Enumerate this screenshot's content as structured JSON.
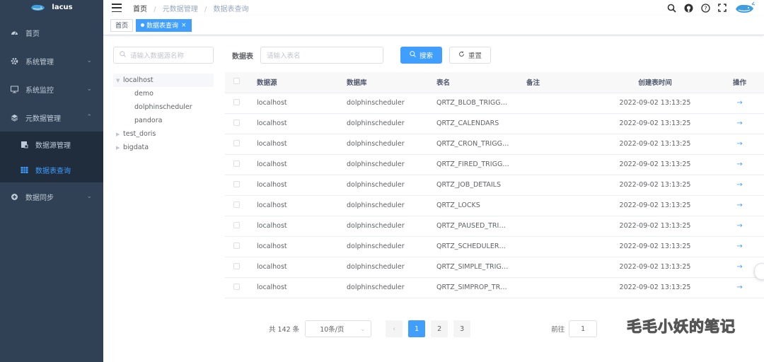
{
  "app": {
    "name": "lacus"
  },
  "sidebar": {
    "items": [
      {
        "label": "首页",
        "icon": "dashboard-icon"
      },
      {
        "label": "系统管理",
        "icon": "gear-icon",
        "expandable": true
      },
      {
        "label": "系统监控",
        "icon": "monitor-icon",
        "expandable": true
      },
      {
        "label": "元数据管理",
        "icon": "layers-icon",
        "expanded": true,
        "children": [
          {
            "label": "数据源管理",
            "icon": "database-icon"
          },
          {
            "label": "数据表查询",
            "icon": "table-icon",
            "active": true
          }
        ]
      },
      {
        "label": "数据同步",
        "icon": "sync-icon",
        "expandable": true
      }
    ]
  },
  "breadcrumb": {
    "home": "首页",
    "level1": "元数据管理",
    "level2": "数据表查询",
    "sep": "/"
  },
  "tags": {
    "home": "首页",
    "active": "数据表查询",
    "close": "×"
  },
  "left": {
    "search_placeholder": "请输入数据源名称",
    "tree": [
      {
        "label": "localhost",
        "expanded": true,
        "children": [
          "demo",
          "dolphinscheduler",
          "pandora"
        ]
      },
      {
        "label": "test_doris",
        "expanded": false
      },
      {
        "label": "bigdata",
        "expanded": false
      }
    ]
  },
  "filter": {
    "label": "数据表",
    "placeholder": "请输入表名",
    "search_button": "搜索",
    "reset_button": "重置"
  },
  "table": {
    "columns": [
      "数据源",
      "数据库",
      "表名",
      "备注",
      "创建表时间",
      "操作"
    ],
    "rows": [
      [
        "localhost",
        "dolphinscheduler",
        "QRTZ_BLOB_TRIGG…",
        "",
        "2022-09-02 13:13:25"
      ],
      [
        "localhost",
        "dolphinscheduler",
        "QRTZ_CALENDARS",
        "",
        "2022-09-02 13:13:25"
      ],
      [
        "localhost",
        "dolphinscheduler",
        "QRTZ_CRON_TRIGG…",
        "",
        "2022-09-02 13:13:25"
      ],
      [
        "localhost",
        "dolphinscheduler",
        "QRTZ_FIRED_TRIGG…",
        "",
        "2022-09-02 13:13:25"
      ],
      [
        "localhost",
        "dolphinscheduler",
        "QRTZ_JOB_DETAILS",
        "",
        "2022-09-02 13:13:25"
      ],
      [
        "localhost",
        "dolphinscheduler",
        "QRTZ_LOCKS",
        "",
        "2022-09-02 13:13:25"
      ],
      [
        "localhost",
        "dolphinscheduler",
        "QRTZ_PAUSED_TRI…",
        "",
        "2022-09-02 13:13:25"
      ],
      [
        "localhost",
        "dolphinscheduler",
        "QRTZ_SCHEDULER…",
        "",
        "2022-09-02 13:13:25"
      ],
      [
        "localhost",
        "dolphinscheduler",
        "QRTZ_SIMPLE_TRIG…",
        "",
        "2022-09-02 13:13:25"
      ],
      [
        "localhost",
        "dolphinscheduler",
        "QRTZ_SIMPROP_TR…",
        "",
        "2022-09-02 13:13:25"
      ]
    ],
    "action_icon": "→"
  },
  "pagination": {
    "total": "共 142 条",
    "page_size": "10条/页",
    "prev": "‹",
    "pages": [
      "1",
      "2",
      "3"
    ],
    "current": "1",
    "goto_label": "前往",
    "goto_value": "1"
  },
  "watermark": "毛毛小妖的笔记",
  "colors": {
    "sidebar": "#304156",
    "accent": "#409eff"
  }
}
